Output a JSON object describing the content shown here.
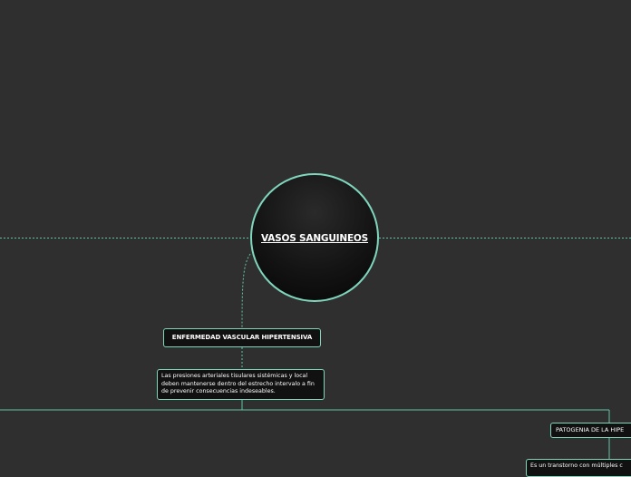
{
  "central": {
    "title": "VASOS SANGUINEOS"
  },
  "topics": [
    {
      "title": "ENFERMEDAD VASCULAR HIPERTENSIVA",
      "note": "Las presiones arteriales tisulares sistémicas y local deben mantenerse dentro del estrecho intervalo a fin de prevenir consecuencias indeseables."
    },
    {
      "title": "PATOGENIA DE LA HIPE",
      "note": "Es un transtorno con múltiples c"
    }
  ],
  "colors": {
    "background": "#302f2f",
    "connector": "#5fc4a8",
    "node_border": "#7fd6bd",
    "node_fill": "#111111",
    "text": "#ffffff"
  }
}
